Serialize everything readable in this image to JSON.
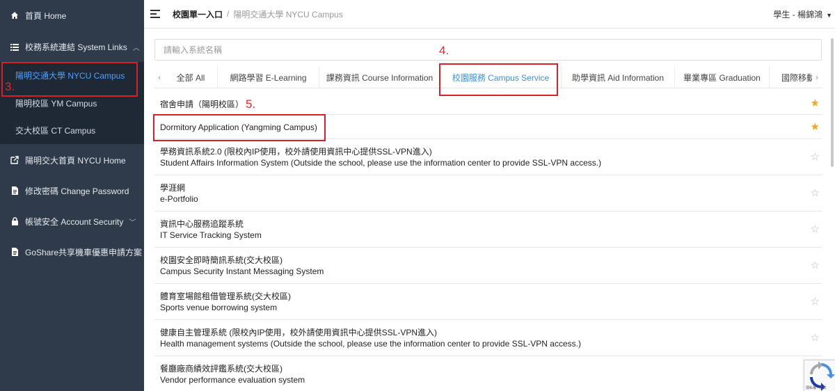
{
  "sidebar": {
    "home": {
      "icon": "home-icon",
      "label": "首頁 Home"
    },
    "system_links": {
      "icon": "list-icon",
      "label": "校務系統連結 System Links"
    },
    "submenu": [
      {
        "label": "陽明交通大學 NYCU Campus"
      },
      {
        "label": "陽明校區 YM Campus"
      },
      {
        "label": "交大校區 CT Campus"
      }
    ],
    "items": [
      {
        "icon": "external-link-icon",
        "label": "陽明交大首頁 NYCU Home"
      },
      {
        "icon": "document-icon",
        "label": "修改密碼 Change Password"
      },
      {
        "icon": "lock-icon",
        "label": "帳號安全 Account Security"
      },
      {
        "icon": "document-icon",
        "label": "GoShare共享機車優惠申請方案"
      }
    ]
  },
  "header": {
    "breadcrumb_root": "校園單一入口",
    "breadcrumb_sep": "/",
    "breadcrumb_current": "陽明交通大學 NYCU Campus",
    "user": "學生 - 楊錦鴻"
  },
  "search": {
    "placeholder": "請輸入系統名稱"
  },
  "tabs": [
    {
      "label": "全部 All"
    },
    {
      "label": "網路學習 E-Learning"
    },
    {
      "label": "課務資訊 Course Information"
    },
    {
      "label": "校園服務 Campus Service",
      "active": true
    },
    {
      "label": "助學資訊 Aid Information"
    },
    {
      "label": "畢業專區 Graduation"
    },
    {
      "label": "國際移動"
    }
  ],
  "rows": [
    {
      "line1": "宿舍申請（陽明校區）",
      "starred": true
    },
    {
      "line1": "Dormitory Application (Yangming Campus)",
      "starred": true
    },
    {
      "line1": "學務資訊系統2.0 (限校內IP使用，校外請使用資訊中心提供SSL-VPN進入)",
      "line2": "Student Affairs Information System (Outside the school, please use the information center to provide SSL-VPN access.)",
      "starred": false
    },
    {
      "line1": "學涯網",
      "line2": "e-Portfolio",
      "starred": false
    },
    {
      "line1": "資訊中心服務追蹤系統",
      "line2": "IT Service Tracking System",
      "starred": false
    },
    {
      "line1": "校園安全即時簡訊系統(交大校區)",
      "line2": "Campus Security Instant Messaging System",
      "starred": false
    },
    {
      "line1": "體育室場館租借管理系統(交大校區)",
      "line2": "Sports venue borrowing system",
      "starred": false
    },
    {
      "line1": "健康自主管理系統 (限校內IP使用，校外請使用資訊中心提供SSL-VPN進入)",
      "line2": "Health management systems (Outside the school, please use the information center to provide SSL-VPN access.)",
      "starred": false
    },
    {
      "line1": "餐廳廠商績效評鑑系統(交大校區)",
      "line2": "Vendor performance evaluation system",
      "starred": false
    }
  ],
  "annotations": [
    {
      "label": "3."
    },
    {
      "label": "4."
    },
    {
      "label": "5."
    }
  ],
  "colors": {
    "sidebar_bg": "#2f3a4b",
    "submenu_bg": "#1f2835",
    "active_blue": "#3d8fe0",
    "annotation_red": "#d7202a",
    "star_gold": "#f5a623"
  },
  "recaptcha": {
    "icon": "recaptcha-icon",
    "text": "隱私權 - 條款"
  }
}
